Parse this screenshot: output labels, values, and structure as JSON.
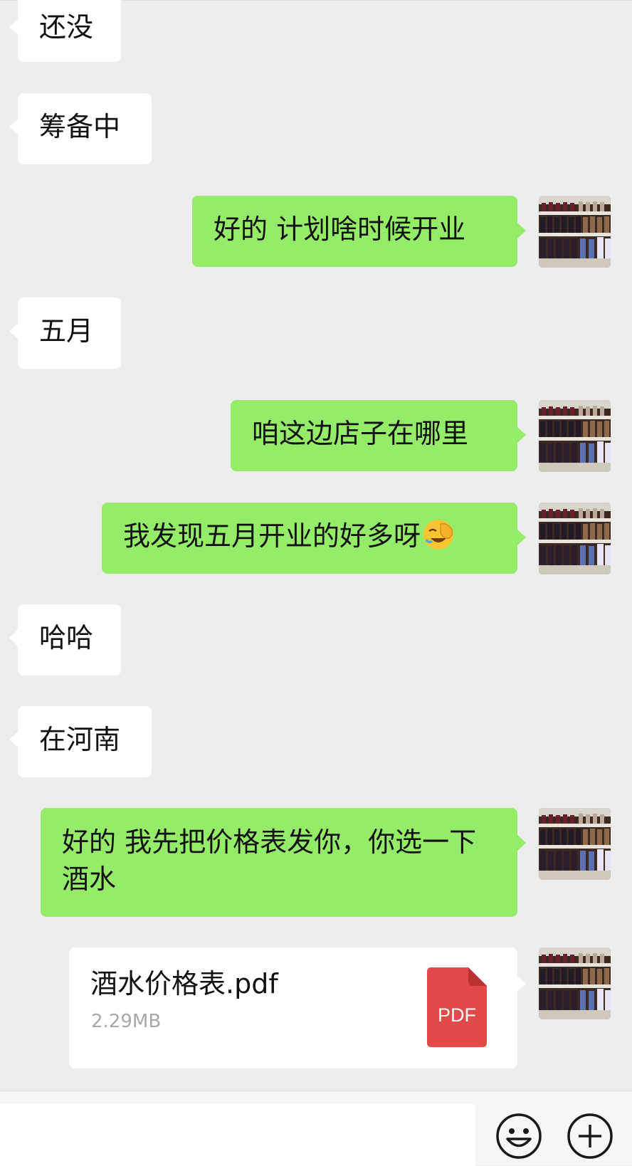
{
  "messages": {
    "m1": "还没",
    "m2": "筹备中",
    "m3": "好的 计划啥时候开业",
    "m4": "五月",
    "m5": "咱这边店子在哪里",
    "m6": "我发现五月开业的好多呀",
    "m7": "哈哈",
    "m8": "在河南",
    "m9": "好的 我先把价格表发你，你选一下酒水"
  },
  "file": {
    "name": "酒水价格表.pdf",
    "size": "2.29MB",
    "badge": "PDF"
  },
  "colors": {
    "background": "#ededed",
    "incoming_bubble": "#ffffff",
    "outgoing_bubble": "#95ec69",
    "pdf_red": "#e24a4a"
  },
  "icons": {
    "emoji_in_m6": "facepalm-laugh-emoji",
    "toolbar": [
      "smiley-icon",
      "plus-circle-icon"
    ]
  }
}
